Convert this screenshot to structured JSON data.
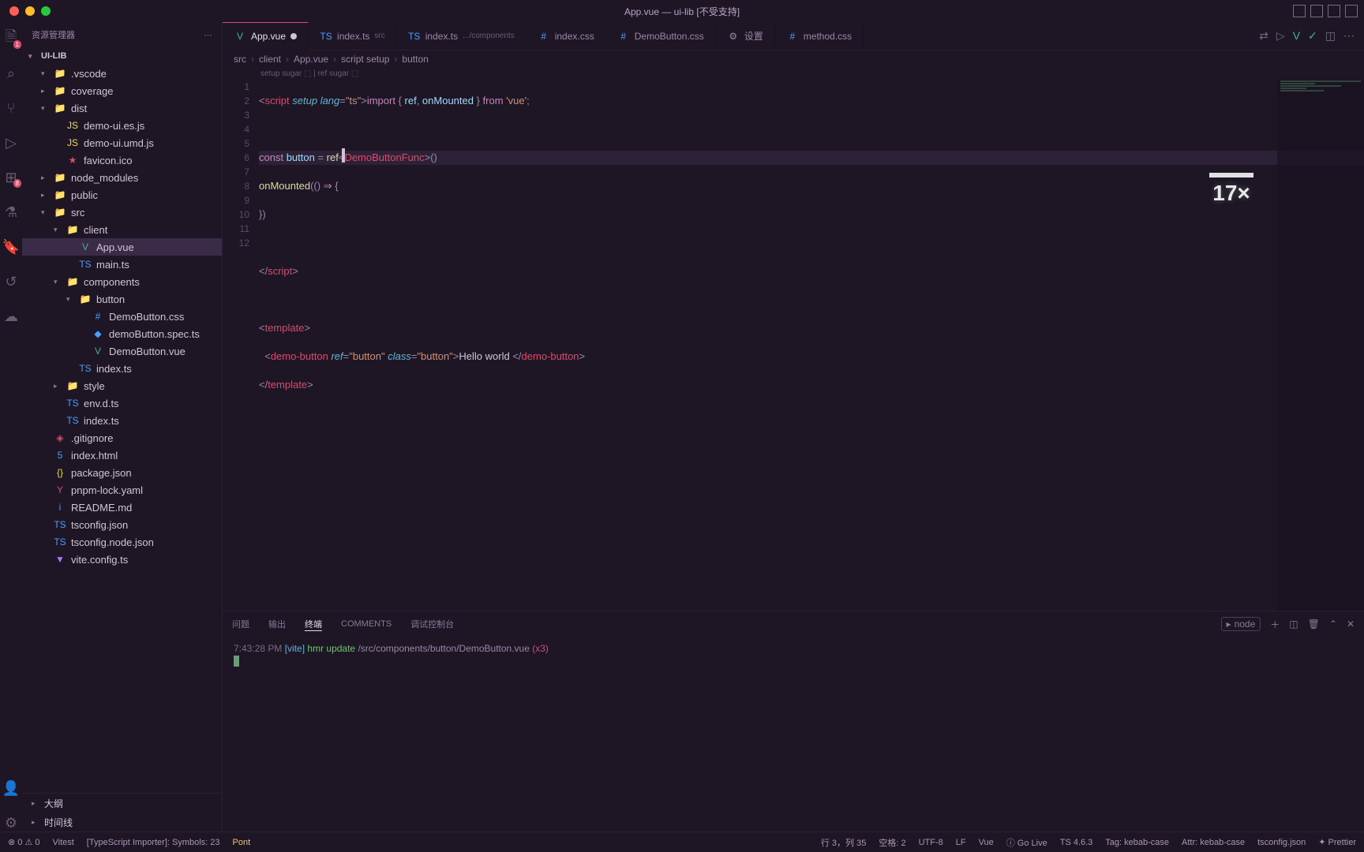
{
  "window_title": "App.vue — ui-lib [不受支持]",
  "sidebar": {
    "header": "资源管理器",
    "root": "UI-LIB",
    "outline": "大纲",
    "timeline": "时间线",
    "tree": [
      {
        "indent": 2,
        "chev": "▾",
        "icon": "📁",
        "cls": "folder-y",
        "name": ".vscode"
      },
      {
        "indent": 2,
        "chev": "▸",
        "icon": "📁",
        "cls": "folder-r",
        "name": "coverage"
      },
      {
        "indent": 2,
        "chev": "▾",
        "icon": "📁",
        "cls": "folder-y",
        "name": "dist"
      },
      {
        "indent": 3,
        "icon": "JS",
        "cls": "clr-js",
        "name": "demo-ui.es.js"
      },
      {
        "indent": 3,
        "icon": "JS",
        "cls": "clr-js",
        "name": "demo-ui.umd.js"
      },
      {
        "indent": 3,
        "icon": "★",
        "cls": "clr-ico",
        "name": "favicon.ico"
      },
      {
        "indent": 2,
        "chev": "▸",
        "icon": "📁",
        "cls": "folder-g",
        "name": "node_modules"
      },
      {
        "indent": 2,
        "chev": "▸",
        "icon": "📁",
        "cls": "folder-b",
        "name": "public"
      },
      {
        "indent": 2,
        "chev": "▾",
        "icon": "📁",
        "cls": "folder-g",
        "name": "src"
      },
      {
        "indent": 3,
        "chev": "▾",
        "icon": "📁",
        "cls": "folder-p",
        "name": "client"
      },
      {
        "indent": 4,
        "icon": "V",
        "cls": "clr-vue",
        "name": "App.vue",
        "sel": true
      },
      {
        "indent": 4,
        "icon": "TS",
        "cls": "clr-ts",
        "name": "main.ts"
      },
      {
        "indent": 3,
        "chev": "▾",
        "icon": "📁",
        "cls": "folder-y",
        "name": "components"
      },
      {
        "indent": 4,
        "chev": "▾",
        "icon": "📁",
        "cls": "folder-y",
        "name": "button"
      },
      {
        "indent": 5,
        "icon": "#",
        "cls": "clr-css",
        "name": "DemoButton.css"
      },
      {
        "indent": 5,
        "icon": "◆",
        "cls": "clr-ts",
        "name": "demoButton.spec.ts"
      },
      {
        "indent": 5,
        "icon": "V",
        "cls": "clr-vue",
        "name": "DemoButton.vue"
      },
      {
        "indent": 4,
        "icon": "TS",
        "cls": "clr-ts",
        "name": "index.ts"
      },
      {
        "indent": 3,
        "chev": "▸",
        "icon": "📁",
        "cls": "folder-b",
        "name": "style"
      },
      {
        "indent": 3,
        "icon": "TS",
        "cls": "clr-ts",
        "name": "env.d.ts"
      },
      {
        "indent": 3,
        "icon": "TS",
        "cls": "clr-ts",
        "name": "index.ts"
      },
      {
        "indent": 2,
        "icon": "◈",
        "cls": "clr-ico",
        "name": ".gitignore"
      },
      {
        "indent": 2,
        "icon": "5",
        "cls": "clr-css",
        "name": "index.html"
      },
      {
        "indent": 2,
        "icon": "{}",
        "cls": "clr-json",
        "name": "package.json"
      },
      {
        "indent": 2,
        "icon": "Y",
        "cls": "clr-yaml",
        "name": "pnpm-lock.yaml"
      },
      {
        "indent": 2,
        "icon": "i",
        "cls": "clr-md",
        "name": "README.md"
      },
      {
        "indent": 2,
        "icon": "TS",
        "cls": "clr-ts",
        "name": "tsconfig.json"
      },
      {
        "indent": 2,
        "icon": "TS",
        "cls": "clr-ts",
        "name": "tsconfig.node.json"
      },
      {
        "indent": 2,
        "icon": "▼",
        "cls": "clr-vite",
        "name": "vite.config.ts"
      }
    ]
  },
  "tabs": [
    {
      "icon": "V",
      "cls": "clr-vue",
      "label": "App.vue",
      "active": true,
      "dirty": true
    },
    {
      "icon": "TS",
      "cls": "clr-ts",
      "label": "index.ts",
      "sub": "src"
    },
    {
      "icon": "TS",
      "cls": "clr-ts",
      "label": "index.ts",
      "sub": ".../components"
    },
    {
      "icon": "#",
      "cls": "clr-css",
      "label": "index.css"
    },
    {
      "icon": "#",
      "cls": "clr-css",
      "label": "DemoButton.css"
    },
    {
      "icon": "⚙",
      "cls": "",
      "label": "设置"
    },
    {
      "icon": "#",
      "cls": "clr-css",
      "label": "method.css"
    }
  ],
  "breadcrumb": [
    "src",
    "client",
    "App.vue",
    "script setup",
    "button"
  ],
  "hints": "setup sugar ⬚ | ref sugar ⬚",
  "code_lines": [
    "1",
    "2",
    "3",
    "4",
    "5",
    "6",
    "7",
    "8",
    "9",
    "10",
    "11",
    "12"
  ],
  "code": {
    "l1_a": "<",
    "l1_b": "script",
    "l1_c": " setup",
    "l1_d": " lang",
    "l1_e": "=",
    "l1_f": "\"ts\"",
    "l1_g": ">",
    "l1_h": "import",
    "l1_i": " { ",
    "l1_j": "ref",
    "l1_k": ", ",
    "l1_l": "onMounted",
    "l1_m": " } ",
    "l1_n": "from",
    "l1_o": " 'vue'",
    "l1_p": ";",
    "l3_a": "const",
    "l3_b": " button ",
    "l3_c": "= ",
    "l3_d": "ref",
    "l3_e": "<",
    "l3_f": "DemoButtonFunc",
    "l3_g": ">",
    "l3_h": "()",
    "l4_a": "onMounted",
    "l4_b": "((",
    "l4_c": ") ",
    "l4_d": "⇒",
    "l4_e": " {",
    "l5": "})",
    "l7_a": "</",
    "l7_b": "script",
    "l7_c": ">",
    "l9_a": "<",
    "l9_b": "template",
    "l9_c": ">",
    "l10_a": "  <",
    "l10_b": "demo-button",
    "l10_c": " ref",
    "l10_d": "=",
    "l10_e": "\"button\"",
    "l10_f": " class",
    "l10_g": "=",
    "l10_h": "\"button\"",
    "l10_i": ">",
    "l10_j": "Hello world ",
    "l10_k": "</",
    "l10_l": "demo-button",
    "l10_m": ">",
    "l11_a": "</",
    "l11_b": "template",
    "l11_c": ">"
  },
  "overlay": "17×",
  "panel": {
    "tabs": [
      "问题",
      "输出",
      "终端",
      "COMMENTS",
      "调试控制台"
    ],
    "active": 2,
    "right_label": "node",
    "terminal": {
      "time": "7:43:28 PM ",
      "vite": "[vite] ",
      "act": "hmr update ",
      "path": "/src/components/button/DemoButton.vue ",
      "cnt": "(x3)"
    }
  },
  "status": {
    "left": [
      "⊗ 0 ⚠ 0",
      "Vitest",
      "[TypeScript Importer]: Symbols: 23"
    ],
    "pont": "Pont",
    "right": [
      "行 3，列 35",
      "空格: 2",
      "UTF-8",
      "LF",
      "Vue",
      "ⓘ Go Live",
      "TS 4.6.3",
      "Tag: kebab-case",
      "Attr: kebab-case",
      "tsconfig.json",
      "✦ Prettier"
    ]
  },
  "activity_badges": {
    "files": "1",
    "ext": "8"
  }
}
